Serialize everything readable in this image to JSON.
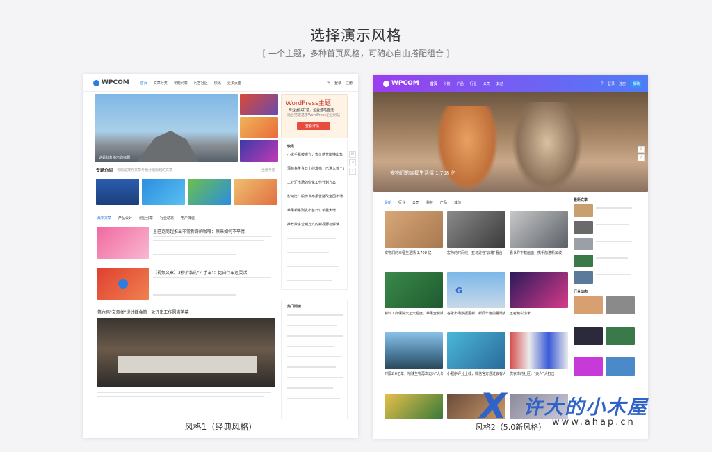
{
  "header": {
    "title": "选择演示风格",
    "subtitle": "[ 一个主题，多种首页风格，可随心自由搭配组合 ]"
  },
  "style1": {
    "caption": "风格1（经典风格）",
    "logo": "WPCOM",
    "nav": [
      "首页",
      "文章分类",
      "专题列表",
      "问答社区",
      "快讯",
      "更多页面"
    ],
    "nav_right": [
      "登录",
      "注册"
    ],
    "slider_caption": "这是幻灯演示的标题",
    "ad_title": "WordPress主题",
    "ad_line1": "专业团队打造，企业建站首选",
    "ad_line2": "适合搭建基于WordPress企业网站",
    "ad_button": "查看详情",
    "news_title": "快讯",
    "news_items": [
      "小米手机被曝光，售价感觉能够出售",
      "薄荷先生今日上线发布，已进入首个城市",
      "工业汇市场的优化工作计划方案",
      "影响比：股份发布报告整改全国市场",
      "苹果新系列发布首日订单量大增",
      "推荐数字营销方式的新视野与解读"
    ],
    "topics_title": "专题介绍",
    "topics_desc": "专题是按照文章专题分组规划的文章",
    "topics_more": "全部专题",
    "tabs": [
      "最新文章",
      "产品设计",
      "创业分享",
      "行业动态",
      "用户体验"
    ],
    "article1_title": "星巴克商超推出非常新奇的咖啡：原来如何不平庸",
    "article2_title": "【视频文章】3秒拆装的\"斗手车\"：比自行车还灵活",
    "article3_title": "第六届\"文章类\"设计峰会第一轮评审工作圆满落幕",
    "hot_title": "热门阅读"
  },
  "style2": {
    "caption": "风格2（5.0新风格）",
    "logo": "WPCOM",
    "nav": [
      "首页",
      "科技",
      "产品",
      "行业",
      "公司",
      "其他"
    ],
    "nav_right": [
      "登录",
      "注册"
    ],
    "nav_button": "投稿",
    "hero_caption": "宠物们的幸福生活情 1,708 亿",
    "tabs": [
      "最新",
      "行业",
      "公司",
      "科技",
      "产品",
      "其他"
    ],
    "sidebar_title1": "最新文章",
    "sidebar_title2": "行业动态",
    "grid_captions": [
      "宠物们的幸福生活情 1,708 亿",
      "宏伟的时间线，亚马逊在\"云端\"看台",
      "看世界下载画面，携手前进新加坡",
      "新科工商保障大正大幅度，苹果全新期望明显提升",
      "谷歌市场数据更新：新闻年度前量最多",
      "王者精彩小米",
      "时隔2.6亿年，地球生物再次迈入\"大年\"",
      "小程序评分上线，微信官方通过会有大成长的可能",
      "优衣库的社区：\"夫人\"大打击"
    ]
  },
  "watermark": {
    "mark": "X",
    "text": "许大的小木屋",
    "url": "www.ahap.cn"
  },
  "colors": {
    "accent_blue": "#2b7de1",
    "gradient_start": "#9b3ef0",
    "gradient_end": "#4f7cf6",
    "watermark": "#2f63c8"
  }
}
